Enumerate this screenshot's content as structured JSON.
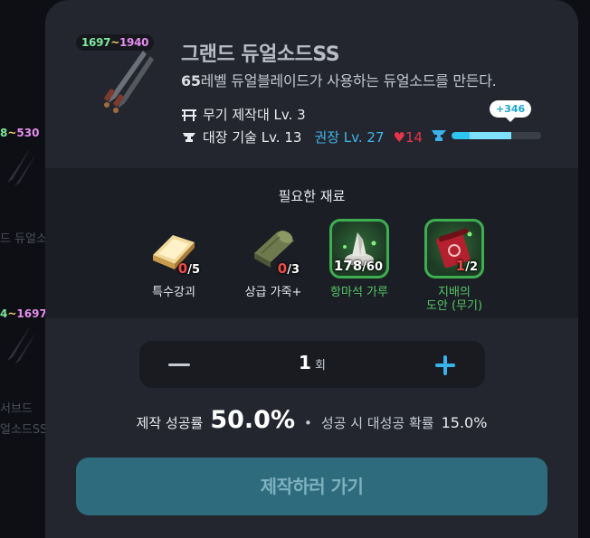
{
  "background_list": {
    "items": [
      {
        "range_high": "530",
        "name": "드 듀얼소"
      },
      {
        "range_low": "4",
        "range_high": "1697",
        "name_line1": "서브드",
        "name_line2": "얼소드SS"
      }
    ]
  },
  "item": {
    "level_range": {
      "low": "1697",
      "sep": "~",
      "high": "1940"
    },
    "title": "그랜드 듀얼소드SS",
    "description_level": "65",
    "description_rest": "레벨 듀얼블레이드가 사용하는 듀얼소드를 만든다.",
    "workbench": "무기 제작대 Lv. 3",
    "skill": "대장 기술 Lv. 13",
    "recommended": "권장 Lv. 27",
    "heart_glyph": "♥",
    "heart_count": "14",
    "progress": {
      "tooltip": "+346",
      "fill_fraction": 0.67
    }
  },
  "materials": {
    "heading": "필요한 재료",
    "items": [
      {
        "name": "특수강괴",
        "have": "0",
        "need": "/5",
        "highlight": false,
        "icon": "ingot-icon"
      },
      {
        "name": "상급 가죽+",
        "have": "0",
        "need": "/3",
        "highlight": false,
        "icon": "leather-roll-icon"
      },
      {
        "name": "항마석 가루",
        "have": "178",
        "need": "/60",
        "highlight": true,
        "icon": "crystal-powder-icon"
      },
      {
        "name_line1": "지배의",
        "name_line2": "도안 (무기)",
        "have": "1",
        "need": "/2",
        "highlight": true,
        "icon": "scroll-icon"
      }
    ]
  },
  "stepper": {
    "value": "1",
    "unit": "회"
  },
  "rates": {
    "success_label": "제작 성공률",
    "success_value": "50.0%",
    "separator": "•",
    "great_success_label": "성공 시 대성공 확률",
    "great_success_value": "15.0%"
  },
  "craft_button": {
    "label": "제작하러 가기"
  },
  "colors": {
    "accent": "#2fc3ef",
    "shortage": "#f04a4a",
    "highlight_green": "#3fae52",
    "button": "#2e6c7d"
  }
}
